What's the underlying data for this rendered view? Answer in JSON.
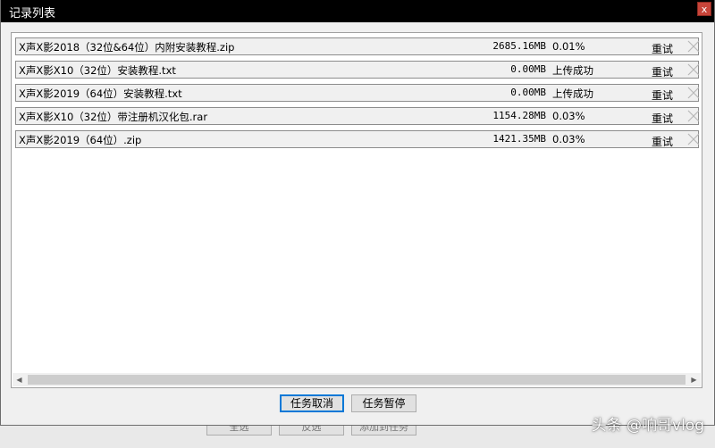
{
  "window": {
    "title": "记录列表",
    "close_label": "x"
  },
  "rows": [
    {
      "name": "X声X影2018（32位&64位）内附安装教程.zip",
      "size": "2685.16MB",
      "status": "0.01%",
      "retry": "重试"
    },
    {
      "name": "X声X影X10（32位）安装教程.txt",
      "size": "0.00MB",
      "status": "上传成功",
      "retry": "重试"
    },
    {
      "name": "X声X影2019（64位）安装教程.txt",
      "size": "0.00MB",
      "status": "上传成功",
      "retry": "重试"
    },
    {
      "name": "X声X影X10（32位）带注册机汉化包.rar",
      "size": "1154.28MB",
      "status": "0.03%",
      "retry": "重试"
    },
    {
      "name": "X声X影2019（64位）.zip",
      "size": "1421.35MB",
      "status": "0.03%",
      "retry": "重试"
    }
  ],
  "buttons": {
    "cancel_task": "任务取消",
    "pause_task": "任务暂停"
  },
  "background_buttons": {
    "select_all": "全选",
    "invert": "反选",
    "add_task": "添加到任务"
  },
  "watermark": "头条 @响哥vlog",
  "colors": {
    "titlebar": "#000000",
    "close": "#c8453a",
    "focus": "#0078d7"
  }
}
